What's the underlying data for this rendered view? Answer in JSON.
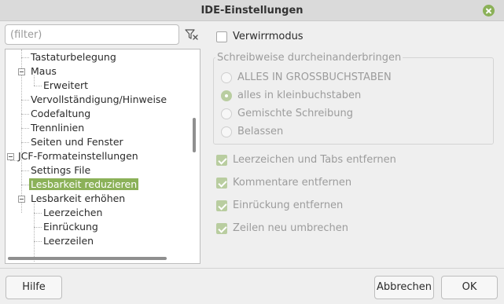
{
  "window": {
    "title": "IDE-Einstellungen"
  },
  "filter": {
    "placeholder": "(filter)",
    "value": ""
  },
  "tree": {
    "items": [
      {
        "label": "Tastaturbelegung"
      },
      {
        "label": "Maus",
        "expanded": true
      },
      {
        "label": "Erweitert"
      },
      {
        "label": "Vervollständigung/Hinweise"
      },
      {
        "label": "Codefaltung"
      },
      {
        "label": "Trennlinien"
      },
      {
        "label": "Seiten und Fenster"
      },
      {
        "label": "JCF-Formateinstellungen",
        "expanded": true
      },
      {
        "label": "Settings File"
      },
      {
        "label": "Lesbarkeit reduzieren",
        "selected": true
      },
      {
        "label": "Lesbarkeit erhöhen",
        "expanded": true
      },
      {
        "label": "Leerzeichen"
      },
      {
        "label": "Einrückung"
      },
      {
        "label": "Leerzeilen"
      }
    ]
  },
  "options": {
    "obfuscate_mode": {
      "label": "Verwirrmodus",
      "checked": false
    },
    "case_group": {
      "title": "Schreibweise durcheinanderbringen",
      "options": [
        {
          "label": "ALLES IN GROSSBUCHSTABEN",
          "selected": false
        },
        {
          "label": "alles in kleinbuchstaben",
          "selected": true
        },
        {
          "label": "Gemischte Schreibung",
          "selected": false
        },
        {
          "label": "Belassen",
          "selected": false
        }
      ]
    },
    "remove_whitespace": {
      "label": "Leerzeichen und Tabs entfernen",
      "checked": true
    },
    "remove_comments": {
      "label": "Kommentare entfernen",
      "checked": true
    },
    "remove_indent": {
      "label": "Einrückung entfernen",
      "checked": true
    },
    "rewrap_lines": {
      "label": "Zeilen neu umbrechen",
      "checked": true
    }
  },
  "buttons": {
    "help": "Hilfe",
    "cancel": "Abbrechen",
    "ok": "OK"
  },
  "colors": {
    "accent": "#8bb158",
    "accent_disabled": "#b9cda0"
  }
}
